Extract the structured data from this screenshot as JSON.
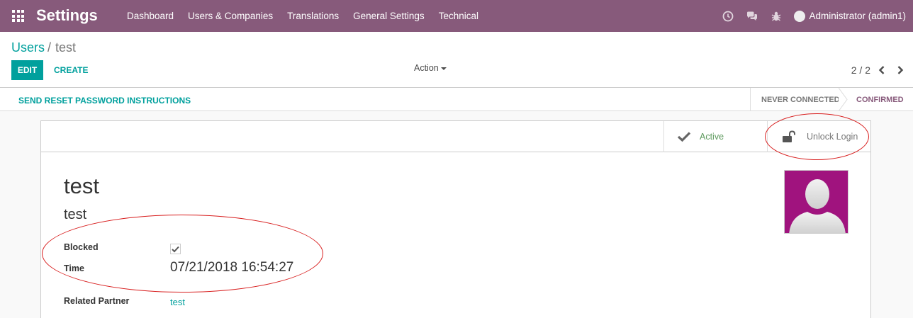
{
  "navbar": {
    "app_title": "Settings",
    "menu": [
      "Dashboard",
      "Users & Companies",
      "Translations",
      "General Settings",
      "Technical"
    ],
    "user_name": "Administrator (admin1)",
    "icons": [
      "clock-icon",
      "chat-icon",
      "bug-icon"
    ]
  },
  "breadcrumb": {
    "parent": "Users",
    "separator": "/",
    "current": "test"
  },
  "toolbar": {
    "edit": "EDIT",
    "create": "CREATE",
    "action": "Action"
  },
  "pager": {
    "value": "2 / 2"
  },
  "statusbar": {
    "reset_password": "SEND RESET PASSWORD INSTRUCTIONS",
    "stages": [
      "NEVER CONNECTED",
      "CONFIRMED"
    ],
    "current_stage": "CONFIRMED"
  },
  "button_box": {
    "active": "Active",
    "unlock": "Unlock Login"
  },
  "form": {
    "name": "test",
    "login": "test",
    "blocked_label": "Blocked",
    "blocked": true,
    "time_label": "Time",
    "time_value": "07/21/2018 16:54:27",
    "partner_label": "Related Partner",
    "partner_value": "test"
  },
  "colors": {
    "brand": "#875a7b",
    "accent": "#00a09d",
    "annotation": "#d81e1e",
    "avatar_bg": "#a0137e",
    "active_green": "#5e9a5e"
  }
}
